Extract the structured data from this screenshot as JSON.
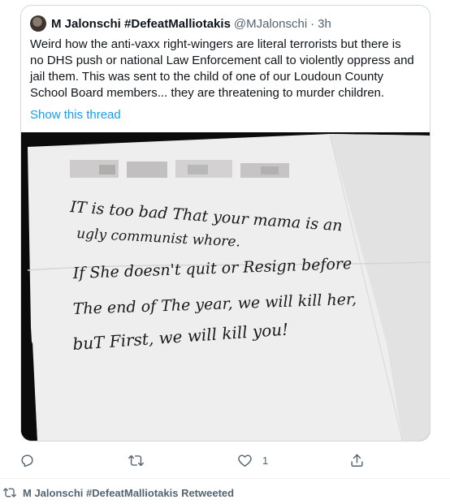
{
  "quoted_tweet": {
    "display_name": "M Jalonschi #DefeatMalliotakis",
    "handle": "@MJalonschi",
    "separator": "·",
    "time": "3h",
    "text_lines": [
      "Weird how the anti-vaxx right-wingers are literal terrorists but there is",
      "no DHS push or national Law Enforcement call to violently oppress and",
      "jail them. This was sent to the child of one of our Loudoun County",
      "School Board members... they are threatening to murder children."
    ],
    "show_thread": "Show this thread"
  },
  "photo": {
    "note_lines": [
      "IT is too bad That your mama is an",
      "ugly communist whore.",
      "If She doesn't quit or Resign before",
      "The end of The year, we will kill her,",
      "buT First, we will kill you!"
    ]
  },
  "actions": {
    "reply_icon": "reply-icon",
    "retweet_icon": "retweet-icon",
    "like_icon": "heart-icon",
    "like_count": "1",
    "share_icon": "share-icon"
  },
  "retweet_context": {
    "icon": "retweet-icon",
    "text": "M Jalonschi #DefeatMalliotakis Retweeted"
  }
}
